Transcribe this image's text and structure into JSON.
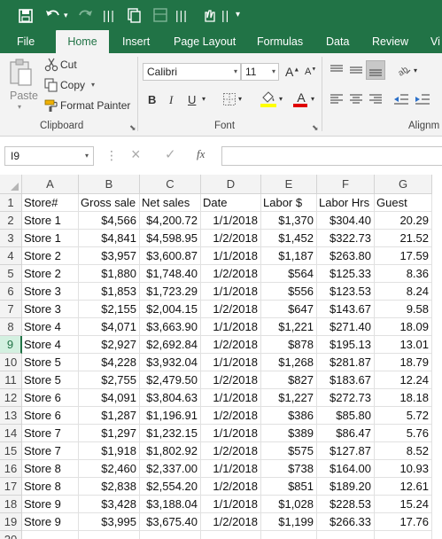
{
  "quick_access": {
    "save_icon": "save-icon",
    "undo_icon": "undo-icon",
    "redo_icon": "redo-icon"
  },
  "tabs": [
    "File",
    "Home",
    "Insert",
    "Page Layout",
    "Formulas",
    "Data",
    "Review",
    "Vi"
  ],
  "active_tab": "Home",
  "clipboard": {
    "paste_label": "Paste",
    "cut_label": "Cut",
    "copy_label": "Copy",
    "format_painter_label": "Format Painter",
    "group_label": "Clipboard"
  },
  "font": {
    "family": "Calibri",
    "size": "11",
    "bold": "B",
    "italic": "I",
    "underline": "U",
    "grow": "A",
    "shrink": "A",
    "font_color": "A",
    "group_label": "Font"
  },
  "alignment": {
    "group_label": "Alignm"
  },
  "formula_bar": {
    "name_box": "I9",
    "fx_label": "fx",
    "cancel_icon": "×",
    "enter_icon": "✓",
    "formula": ""
  },
  "sheet": {
    "columns": [
      "A",
      "B",
      "C",
      "D",
      "E",
      "F",
      "G"
    ],
    "row_numbers": [
      "1",
      "2",
      "3",
      "4",
      "5",
      "6",
      "7",
      "8",
      "9",
      "10",
      "11",
      "12",
      "13",
      "14",
      "15",
      "16",
      "17",
      "18",
      "19",
      "20"
    ],
    "selected_row": "9",
    "headers": [
      "Store#",
      "Gross sale",
      "Net sales",
      "Date",
      "Labor $",
      "Labor Hrs",
      "Guest"
    ],
    "rows": [
      [
        "Store 1",
        "$4,566",
        "$4,200.72",
        "1/1/2018",
        "$1,370",
        "$304.40",
        "20.29"
      ],
      [
        "Store 1",
        "$4,841",
        "$4,598.95",
        "1/2/2018",
        "$1,452",
        "$322.73",
        "21.52"
      ],
      [
        "Store 2",
        "$3,957",
        "$3,600.87",
        "1/1/2018",
        "$1,187",
        "$263.80",
        "17.59"
      ],
      [
        "Store 2",
        "$1,880",
        "$1,748.40",
        "1/2/2018",
        "$564",
        "$125.33",
        "8.36"
      ],
      [
        "Store 3",
        "$1,853",
        "$1,723.29",
        "1/1/2018",
        "$556",
        "$123.53",
        "8.24"
      ],
      [
        "Store 3",
        "$2,155",
        "$2,004.15",
        "1/2/2018",
        "$647",
        "$143.67",
        "9.58"
      ],
      [
        "Store 4",
        "$4,071",
        "$3,663.90",
        "1/1/2018",
        "$1,221",
        "$271.40",
        "18.09"
      ],
      [
        "Store 4",
        "$2,927",
        "$2,692.84",
        "1/2/2018",
        "$878",
        "$195.13",
        "13.01"
      ],
      [
        "Store 5",
        "$4,228",
        "$3,932.04",
        "1/1/2018",
        "$1,268",
        "$281.87",
        "18.79"
      ],
      [
        "Store 5",
        "$2,755",
        "$2,479.50",
        "1/2/2018",
        "$827",
        "$183.67",
        "12.24"
      ],
      [
        "Store 6",
        "$4,091",
        "$3,804.63",
        "1/1/2018",
        "$1,227",
        "$272.73",
        "18.18"
      ],
      [
        "Store 6",
        "$1,287",
        "$1,196.91",
        "1/2/2018",
        "$386",
        "$85.80",
        "5.72"
      ],
      [
        "Store 7",
        "$1,297",
        "$1,232.15",
        "1/1/2018",
        "$389",
        "$86.47",
        "5.76"
      ],
      [
        "Store 7",
        "$1,918",
        "$1,802.92",
        "1/2/2018",
        "$575",
        "$127.87",
        "8.52"
      ],
      [
        "Store 8",
        "$2,460",
        "$2,337.00",
        "1/1/2018",
        "$738",
        "$164.00",
        "10.93"
      ],
      [
        "Store 8",
        "$2,838",
        "$2,554.20",
        "1/2/2018",
        "$851",
        "$189.20",
        "12.61"
      ],
      [
        "Store 9",
        "$3,428",
        "$3,188.04",
        "1/1/2018",
        "$1,028",
        "$228.53",
        "15.24"
      ],
      [
        "Store 9",
        "$3,995",
        "$3,675.40",
        "1/2/2018",
        "$1,199",
        "$266.33",
        "17.76"
      ]
    ]
  },
  "colors": {
    "excel_green": "#217346",
    "ribbon_bg": "#f3f3f3",
    "selected_row_header": "#d3f0e0"
  }
}
